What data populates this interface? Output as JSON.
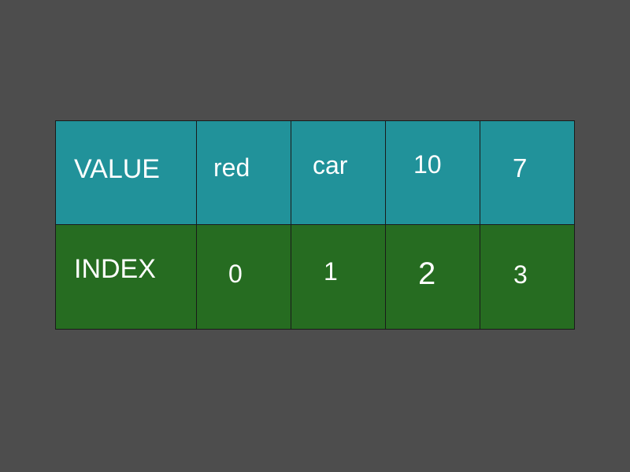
{
  "table": {
    "value_row": {
      "header": "VALUE",
      "cells": [
        "red",
        "car",
        "10",
        "7"
      ]
    },
    "index_row": {
      "header": "INDEX",
      "cells": [
        "0",
        "1",
        "2",
        "3"
      ]
    }
  },
  "colors": {
    "background": "#4d4d4d",
    "value_row": "#21929a",
    "index_row": "#266c21",
    "text": "#ffffff",
    "border": "#1a1a1a"
  }
}
